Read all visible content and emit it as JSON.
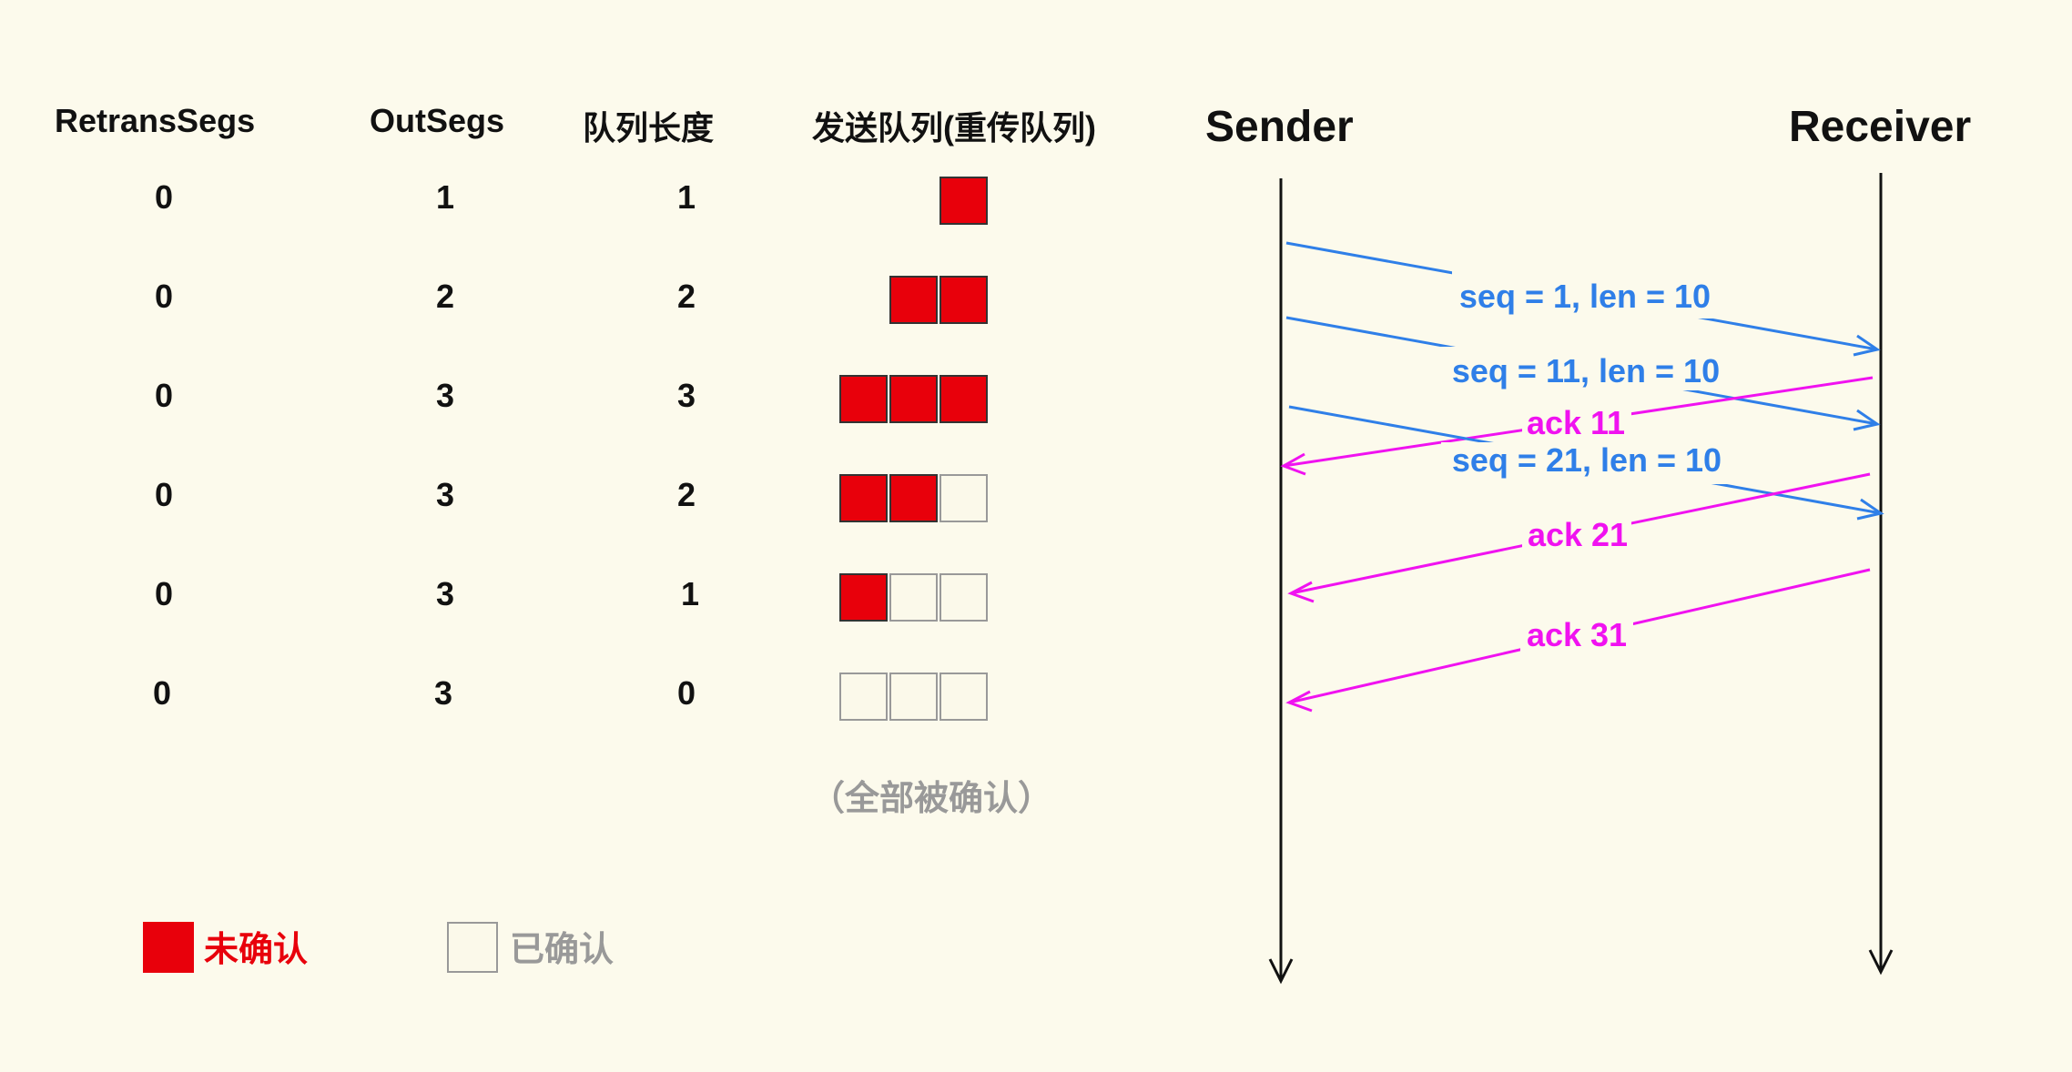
{
  "table": {
    "headers": [
      "RetransSegs",
      "OutSegs",
      "队列长度",
      "发送队列(重传队列)"
    ],
    "rows": [
      {
        "retrans": "0",
        "out": "1",
        "len": "1",
        "queue": [
          "unacked"
        ]
      },
      {
        "retrans": "0",
        "out": "2",
        "len": "2",
        "queue": [
          "unacked",
          "unacked"
        ]
      },
      {
        "retrans": "0",
        "out": "3",
        "len": "3",
        "queue": [
          "unacked",
          "unacked",
          "unacked"
        ]
      },
      {
        "retrans": "0",
        "out": "3",
        "len": "2",
        "queue": [
          "unacked",
          "unacked",
          "acked"
        ]
      },
      {
        "retrans": "0",
        "out": "3",
        "len": "1",
        "queue": [
          "unacked",
          "acked",
          "acked"
        ]
      },
      {
        "retrans": "0",
        "out": "3",
        "len": "0",
        "queue": [
          "acked",
          "acked",
          "acked"
        ]
      }
    ],
    "note": "（全部被确认）"
  },
  "legend": {
    "unacked_label": "未确认",
    "acked_label": "已确认"
  },
  "sequence": {
    "sender_label": "Sender",
    "receiver_label": "Receiver",
    "messages": [
      {
        "label": "seq = 1, len = 10",
        "direction": "sender-to-receiver"
      },
      {
        "label": "seq = 11, len = 10",
        "direction": "sender-to-receiver"
      },
      {
        "label": "ack 11",
        "direction": "receiver-to-sender"
      },
      {
        "label": "seq = 21, len = 10",
        "direction": "sender-to-receiver"
      },
      {
        "label": "ack 21",
        "direction": "receiver-to-sender"
      },
      {
        "label": "ack 31",
        "direction": "receiver-to-sender"
      }
    ]
  },
  "colors": {
    "background": "#fcfaec",
    "unacked": "#e8000b",
    "acked_border": "#999999",
    "data_arrow": "#2f7fe8",
    "ack_arrow": "#f012f0"
  }
}
